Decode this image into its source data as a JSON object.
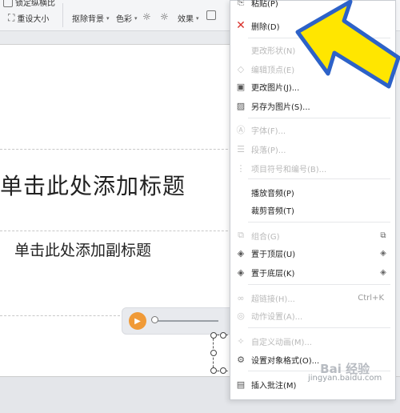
{
  "toolbar": {
    "row1_left": "锁定纵横比",
    "reset_size": "重设大小",
    "remove_bg": "抠除背景",
    "color": "色彩",
    "effects": "效果"
  },
  "slide": {
    "title": "单击此处添加标题",
    "subtitle": "单击此处添加副标题"
  },
  "menu": {
    "top_partial": "粘贴(P)",
    "items": [
      {
        "label": "删除(D)",
        "icon": "x-icon"
      },
      {
        "label": "更改形状(N)",
        "icon": "none"
      },
      {
        "label": "编辑顶点(E)",
        "icon": "edit-points-icon"
      },
      {
        "label": "更改图片(J)...",
        "icon": "change-image-icon"
      },
      {
        "label": "另存为图片(S)...",
        "icon": "save-image-icon"
      },
      {
        "label": "字体(F)...",
        "icon": "font-icon"
      },
      {
        "label": "段落(P)...",
        "icon": "paragraph-icon"
      },
      {
        "label": "项目符号和编号(B)...",
        "icon": "bullets-icon"
      },
      {
        "label": "播放音频(P)",
        "icon": "none"
      },
      {
        "label": "裁剪音频(T)",
        "icon": "none"
      },
      {
        "label": "组合(G)",
        "icon": "group-icon"
      },
      {
        "label": "置于顶层(U)",
        "icon": "bring-to-front-icon"
      },
      {
        "label": "置于底层(K)",
        "icon": "send-to-back-icon"
      },
      {
        "label": "超链接(H)...",
        "icon": "link-icon",
        "shortcut": "Ctrl+K"
      },
      {
        "label": "动作设置(A)...",
        "icon": "action-icon"
      },
      {
        "label": "自定义动画(M)...",
        "icon": "animation-icon"
      },
      {
        "label": "设置对象格式(O)...",
        "icon": "format-object-icon"
      },
      {
        "label": "插入批注(M)",
        "icon": "comment-icon"
      }
    ]
  },
  "watermark": {
    "brand": "Bai 经验",
    "url": "jingyan.baidu.com"
  },
  "colors": {
    "accent_orange": "#f09a37",
    "arrow_yellow": "#ffe600",
    "arrow_outline": "#2d62c8",
    "delete_red": "#d9312b"
  }
}
